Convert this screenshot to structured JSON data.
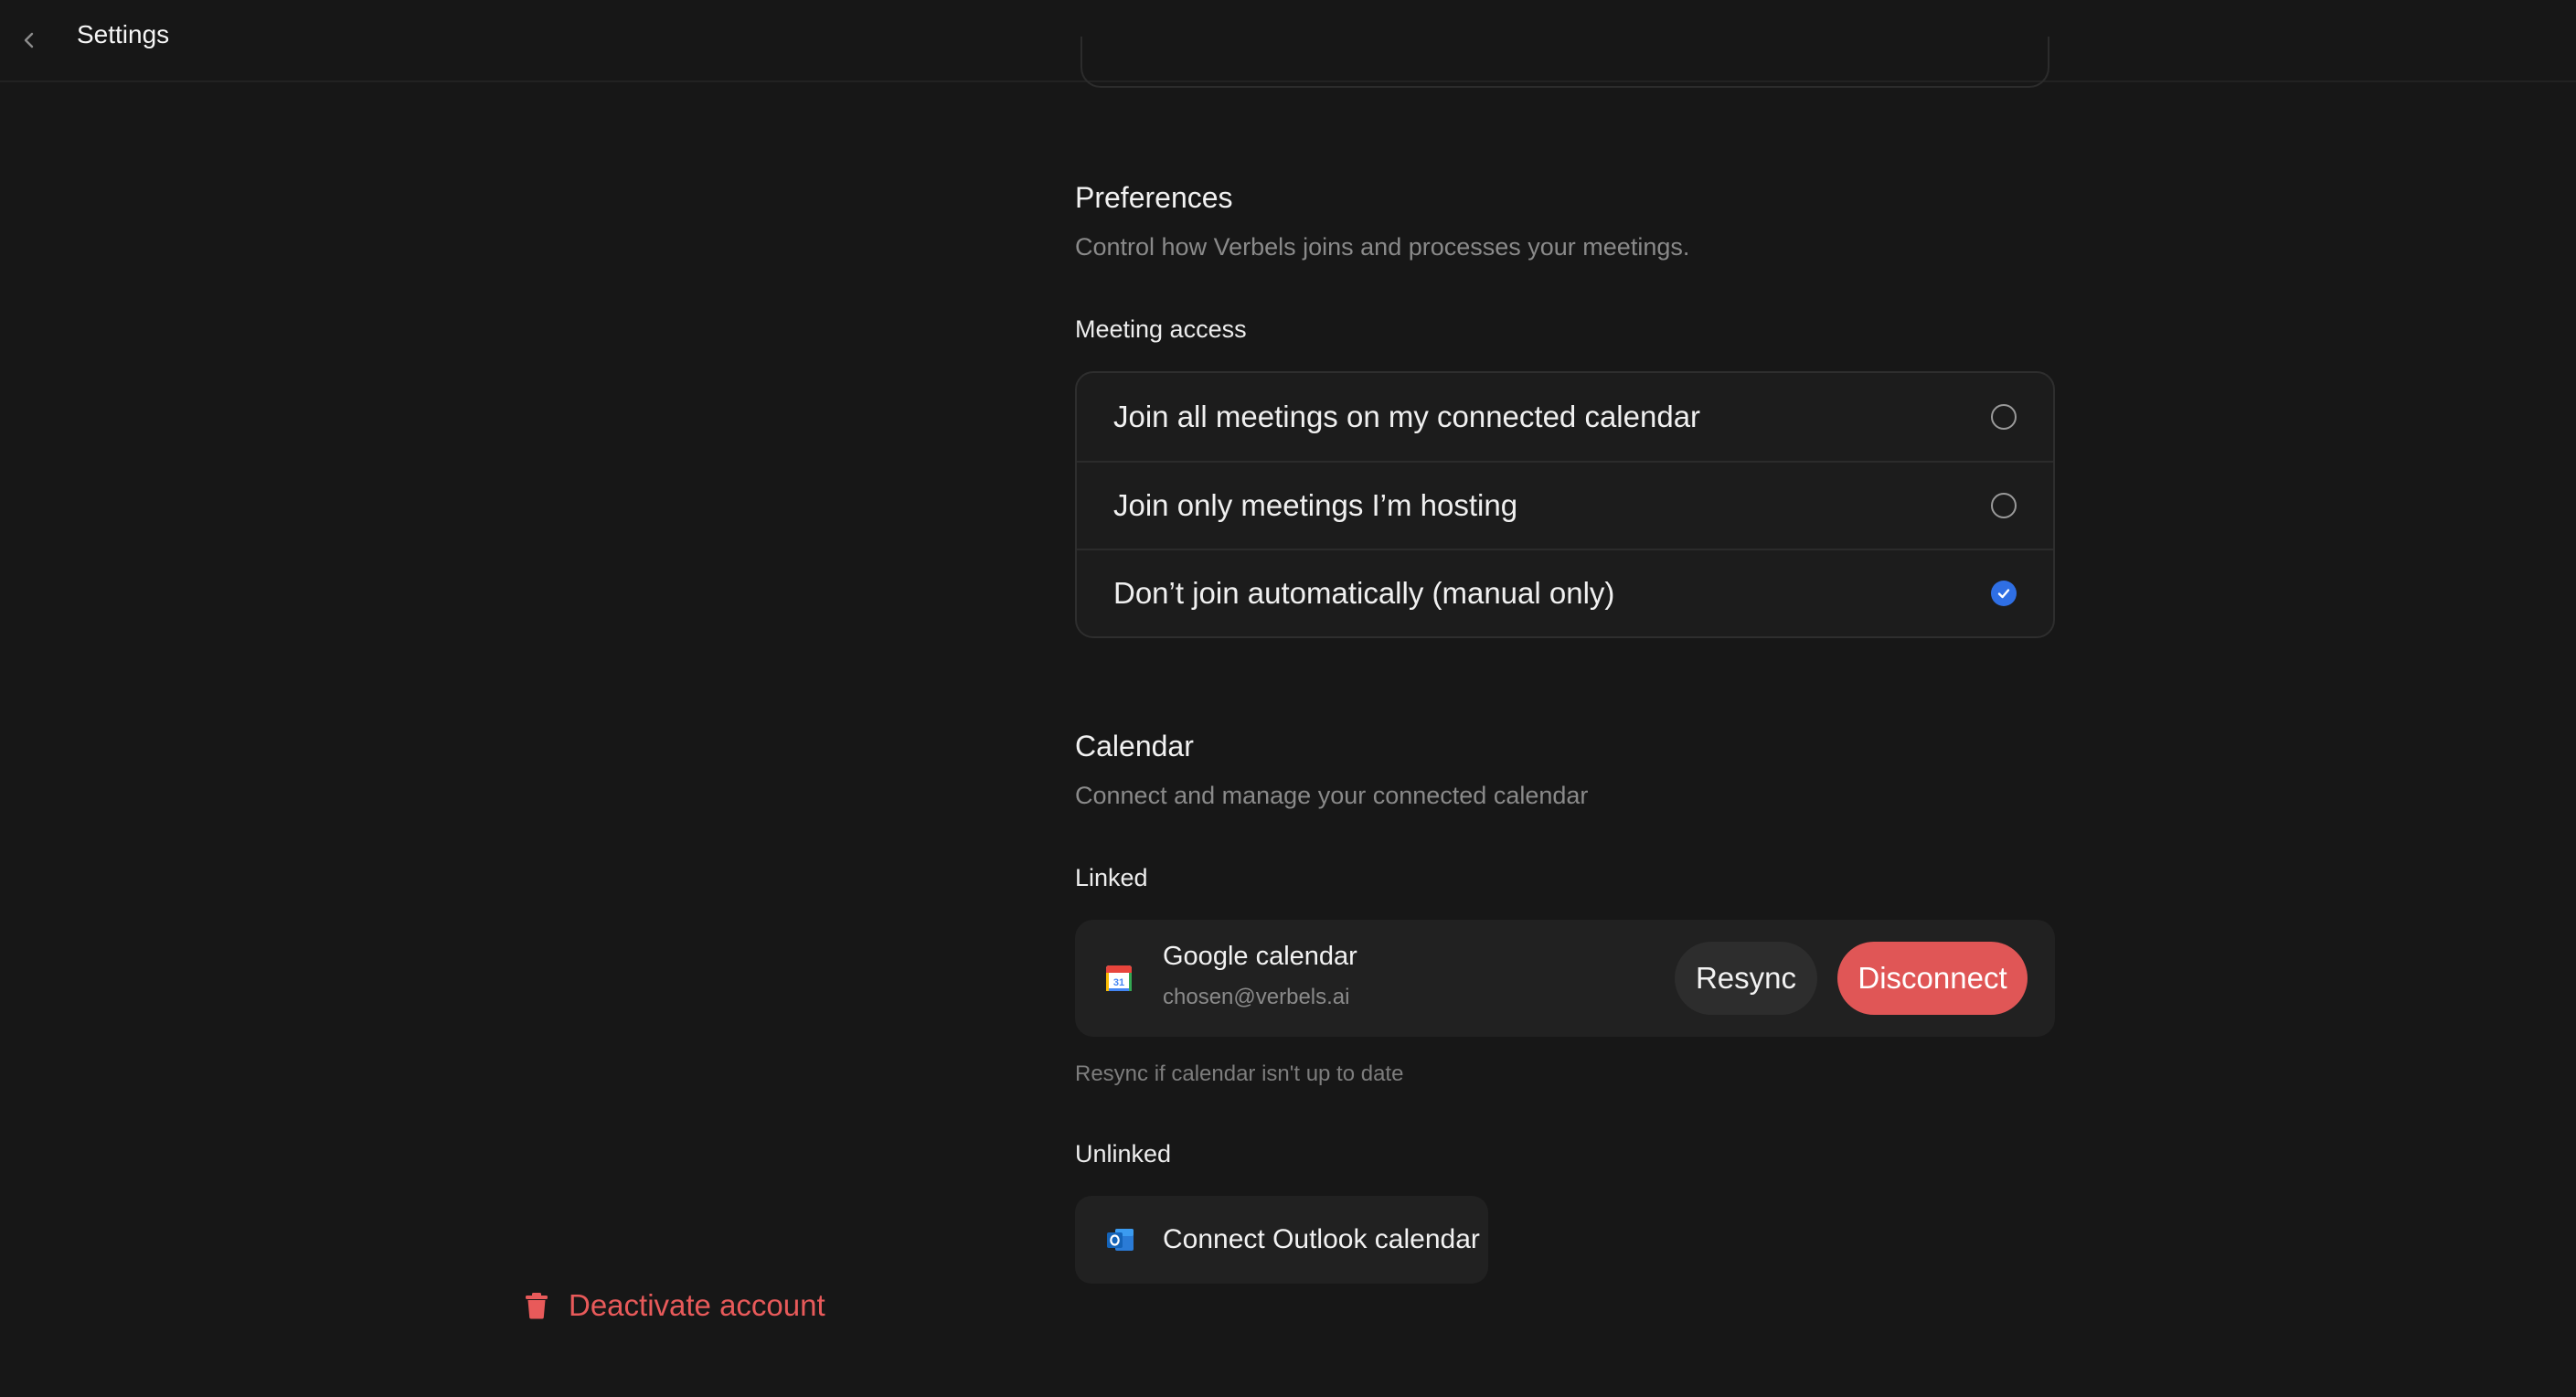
{
  "header": {
    "title": "Settings",
    "back_icon": "chevron-left-icon"
  },
  "preferences": {
    "title": "Preferences",
    "description": "Control how Verbels joins and processes your meetings.",
    "meeting_access_label": "Meeting access",
    "options": [
      {
        "label": "Join all meetings on my connected calendar",
        "selected": false
      },
      {
        "label": "Join only meetings I’m hosting",
        "selected": false
      },
      {
        "label": "Don’t join automatically (manual only)",
        "selected": true
      }
    ]
  },
  "calendar": {
    "title": "Calendar",
    "description": "Connect and manage your connected calendar",
    "linked_label": "Linked",
    "linked_item": {
      "name": "Google calendar",
      "email": "chosen@verbels.ai",
      "icon": "google-calendar-icon",
      "resync_label": "Resync",
      "disconnect_label": "Disconnect"
    },
    "resync_hint": "Resync if calendar isn't up to date",
    "unlinked_label": "Unlinked",
    "connect_outlook_label": "Connect Outlook calendar",
    "outlook_icon": "outlook-icon"
  },
  "account": {
    "deactivate_label": "Deactivate account",
    "deactivate_icon": "trash-icon"
  },
  "colors": {
    "background": "#171717",
    "accent_blue": "#2f6fe4",
    "danger_red": "#e05656"
  }
}
